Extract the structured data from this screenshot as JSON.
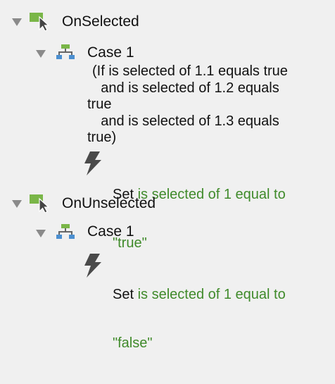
{
  "colors": {
    "accent_green": "#3f8a2a",
    "icon_green": "#7ab648",
    "icon_blue": "#4b8fd0",
    "icon_gray": "#666666"
  },
  "events": [
    {
      "label": "OnSelected",
      "icon": "event-cursor-icon",
      "case": {
        "label": "Case 1",
        "icon": "case-tree-icon",
        "condition_lines": [
          "(If is selected of 1.1 equals true",
          "    and is selected of 1.2 equals",
          "true",
          "    and is selected of 1.3 equals",
          "true)"
        ],
        "action": {
          "icon": "lightning-icon",
          "verb": "Set",
          "detail_line1": "is selected of 1 equal to",
          "detail_line2": "\"true\""
        }
      }
    },
    {
      "label": "OnUnselected",
      "icon": "event-cursor-icon",
      "case": {
        "label": "Case 1",
        "icon": "case-tree-icon",
        "action": {
          "icon": "lightning-icon",
          "verb": "Set",
          "detail_line1": "is selected of 1 equal to",
          "detail_line2": "\"false\""
        }
      }
    }
  ]
}
